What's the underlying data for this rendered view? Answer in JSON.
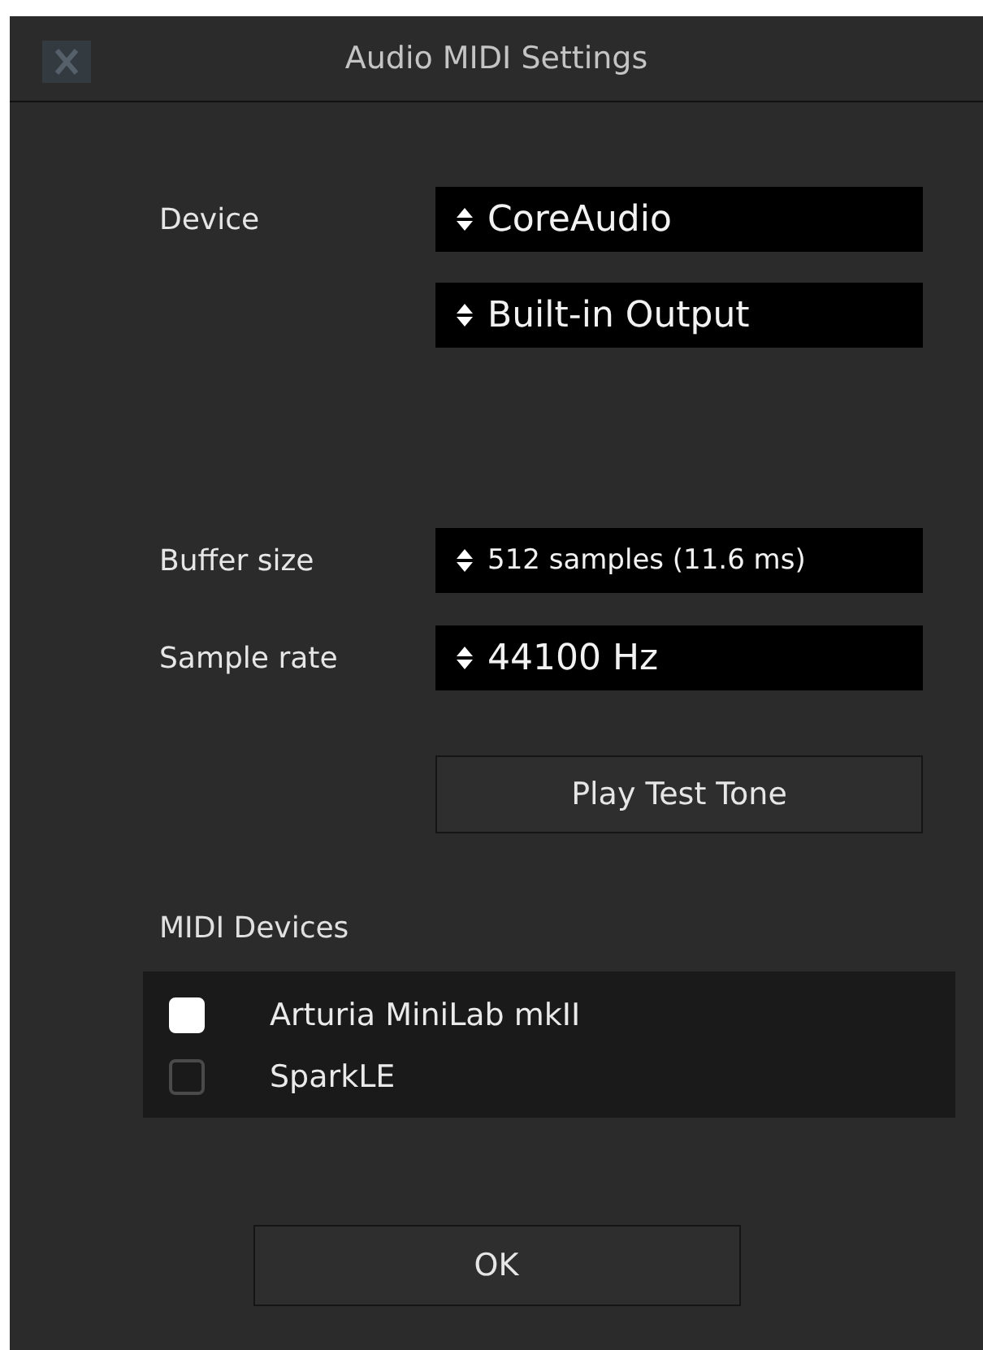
{
  "window": {
    "title": "Audio MIDI Settings"
  },
  "settings": [
    {
      "label": "Device",
      "value": "CoreAudio"
    },
    {
      "value": "Built-in Output"
    },
    {
      "label": "Buffer size",
      "value": "512 samples (11.6 ms)"
    },
    {
      "label": "Sample rate",
      "value": "44100 Hz"
    }
  ],
  "test_button": "Play Test Tone",
  "midi": {
    "heading": "MIDI Devices",
    "devices": [
      {
        "name": "Arturia MiniLab mkII",
        "checked": true
      },
      {
        "name": "SparkLE",
        "checked": false
      }
    ]
  },
  "ok_button": "OK"
}
